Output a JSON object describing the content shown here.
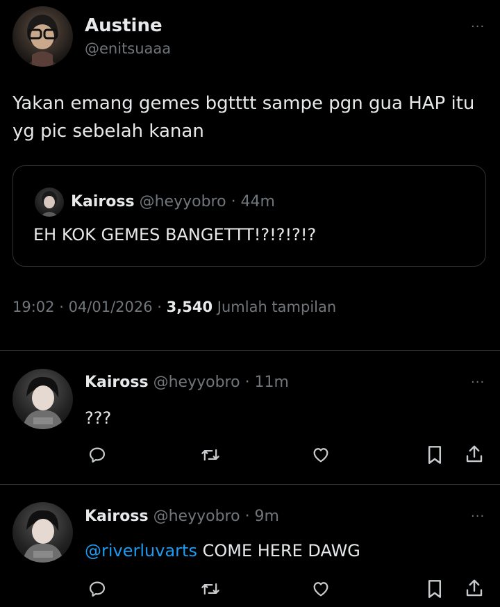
{
  "main_tweet": {
    "name": "Austine",
    "handle": "@enitsuaaa",
    "text_line1": "Yakan emang gemes bgtttt sampe pgn gua HAP itu",
    "text_line2": "yg pic sebelah kanan",
    "more": "···",
    "quote": {
      "name": "Kaiross",
      "handle": "@heyyobro",
      "time": "· 44m",
      "text": "EH KOK GEMES BANGETTT!?!?!?!?"
    },
    "meta": {
      "time": "19:02",
      "date": "· 04/01/2026 ·",
      "views": "3,540",
      "views_label": "Jumlah tampilan"
    }
  },
  "replies": [
    {
      "name": "Kaiross",
      "handle": "@heyyobro",
      "time": "· 11m",
      "text": "???",
      "more": "···"
    },
    {
      "name": "Kaiross",
      "handle": "@heyyobro",
      "time": "· 9m",
      "mention": "@riverluvarts",
      "text": " COME HERE DAWG",
      "more": "···"
    }
  ],
  "colors": {
    "background": "#000000",
    "text": "#e7e9ea",
    "secondary": "#71767b",
    "link": "#1d9bf0",
    "border": "#2f3336"
  },
  "icons": [
    "reply-icon",
    "retweet-icon",
    "like-icon",
    "bookmark-icon",
    "share-icon",
    "more-icon"
  ]
}
